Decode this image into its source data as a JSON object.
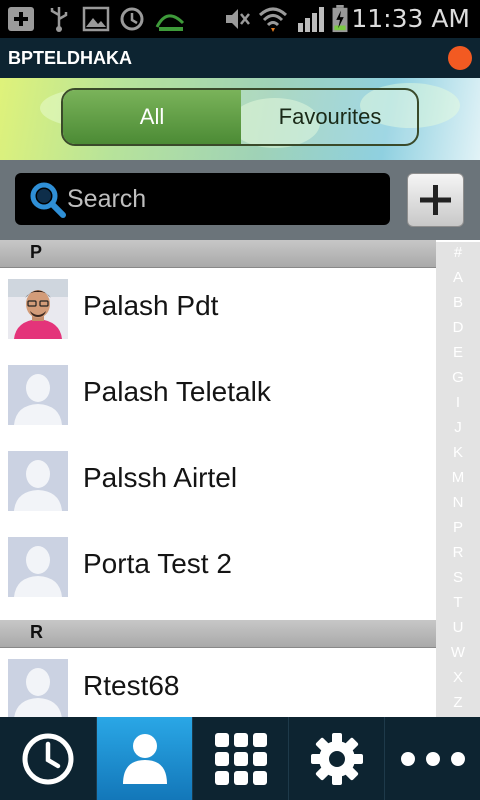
{
  "status_bar": {
    "time": "11:33 AM",
    "icons": [
      "add-box-icon",
      "usb-icon",
      "image-icon",
      "sync-icon",
      "dhaka-logo-icon",
      "mute-icon",
      "wifi-icon",
      "signal-icon",
      "battery-charging-icon"
    ]
  },
  "header": {
    "title": "BPTELDHAKA",
    "status_color": "#f25a22"
  },
  "tabs": {
    "all_label": "All",
    "favourites_label": "Favourites",
    "selected": "All"
  },
  "search": {
    "placeholder": "Search"
  },
  "contacts": {
    "sections": [
      {
        "letter": "P",
        "items": [
          {
            "name": "Palash Pdt",
            "avatar": "photo"
          },
          {
            "name": "Palash Teletalk",
            "avatar": "default"
          },
          {
            "name": "Palssh Airtel",
            "avatar": "default"
          },
          {
            "name": "Porta Test 2",
            "avatar": "default"
          }
        ]
      },
      {
        "letter": "R",
        "items": [
          {
            "name": "Rtest68",
            "avatar": "default"
          }
        ]
      }
    ]
  },
  "index": [
    "#",
    "A",
    "B",
    "D",
    "E",
    "G",
    "I",
    "J",
    "K",
    "M",
    "N",
    "P",
    "R",
    "S",
    "T",
    "U",
    "W",
    "X",
    "Z"
  ],
  "bottom_nav": {
    "items": [
      {
        "icon": "clock-icon",
        "active": false
      },
      {
        "icon": "contacts-icon",
        "active": true
      },
      {
        "icon": "dialpad-icon",
        "active": false
      },
      {
        "icon": "settings-icon",
        "active": false
      },
      {
        "icon": "more-icon",
        "active": false
      }
    ]
  },
  "colors": {
    "accent": "#1b8ed1",
    "header_bg": "#0d2431",
    "tab_selected": "#5f9d44"
  }
}
